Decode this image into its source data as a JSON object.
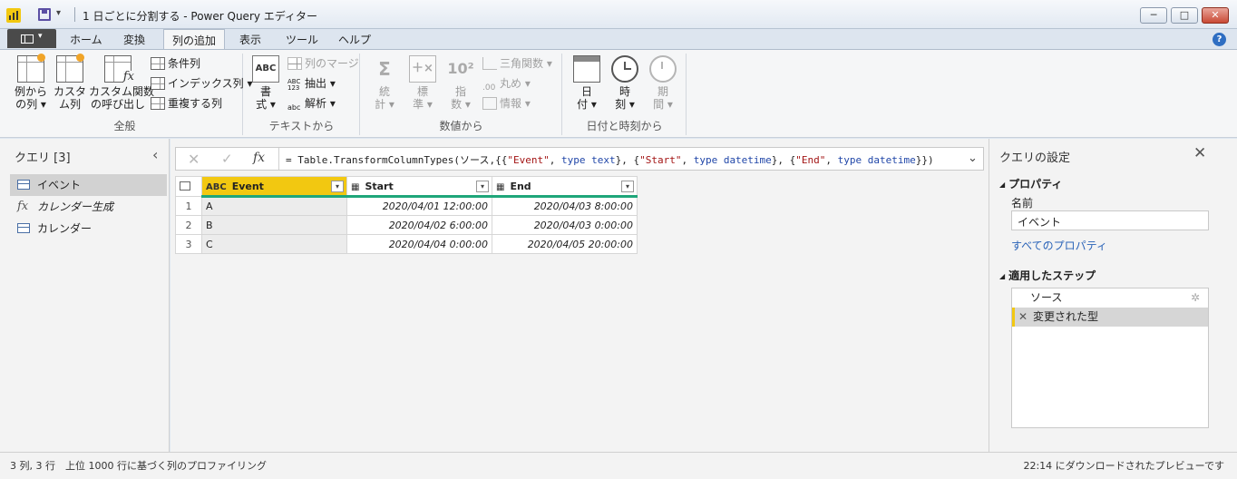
{
  "window": {
    "title": "1 日ごとに分割する - Power Query エディター",
    "qat_dropdown": "▾",
    "controls": {
      "minimize": "─",
      "maximize": "□",
      "close": "✕"
    }
  },
  "tabs": {
    "file_dropdown": "▾",
    "items": [
      "ホーム",
      "変換",
      "列の追加",
      "表示",
      "ツール",
      "ヘルプ"
    ],
    "active": "列の追加",
    "help": "?"
  },
  "ribbon": {
    "general": {
      "label": "全般",
      "example_col": "例から\nの列 ▾",
      "custom_col": "カスタ\nム列",
      "invoke_func": "カスタム関数\nの呼び出し",
      "conditional": "条件列",
      "index": "インデックス列 ▾",
      "duplicate": "重複する列"
    },
    "text": {
      "label": "テキストから",
      "format": "書\n式 ▾",
      "merge": "列のマージ",
      "extract": "抽出 ▾",
      "parse": "解析 ▾"
    },
    "number": {
      "label": "数値から",
      "stats": "統\n計 ▾",
      "standard": "標\n準 ▾",
      "scientific": "指\n数 ▾",
      "trig": "三角関数 ▾",
      "rounding": "丸め ▾",
      "info": "情報 ▾",
      "scientific_glyph": "10²"
    },
    "datetime": {
      "label": "日付と時刻から",
      "date": "日\n付 ▾",
      "time": "時\n刻 ▾",
      "duration": "期\n間 ▾"
    }
  },
  "queries": {
    "title": "クエリ [3]",
    "collapse": "‹",
    "items": [
      {
        "label": "イベント",
        "type": "table",
        "selected": true
      },
      {
        "label": "カレンダー生成",
        "type": "function",
        "selected": false
      },
      {
        "label": "カレンダー",
        "type": "table",
        "selected": false
      }
    ]
  },
  "formula_bar": {
    "cancel": "✕",
    "commit": "✓",
    "fx": "fx",
    "expand": "⌄",
    "text": "= Table.TransformColumnTypes(ソース,{{\"Event\", type text}, {\"Start\", type datetime}, {\"End\", type datetime}})"
  },
  "grid": {
    "columns": [
      {
        "name": "Event",
        "type": "ABC",
        "selected": true
      },
      {
        "name": "Start",
        "type": "datetime",
        "selected": false
      },
      {
        "name": "End",
        "type": "datetime",
        "selected": false
      }
    ],
    "rows": [
      [
        "1",
        "A",
        "2020/04/01 12:00:00",
        "2020/04/03 8:00:00"
      ],
      [
        "2",
        "B",
        "2020/04/02 6:00:00",
        "2020/04/03 0:00:00"
      ],
      [
        "3",
        "C",
        "2020/04/04 0:00:00",
        "2020/04/05 20:00:00"
      ]
    ],
    "dropdown": "▾"
  },
  "settings": {
    "title": "クエリの設定",
    "close": "✕",
    "properties_header": "プロパティ",
    "name_label": "名前",
    "name_value": "イベント",
    "all_props": "すべてのプロパティ",
    "steps_header": "適用したステップ",
    "section_toggle": "◢",
    "steps": [
      {
        "label": "ソース",
        "selected": false,
        "has_gear": true
      },
      {
        "label": "変更された型",
        "selected": true,
        "has_gear": false
      }
    ],
    "step_delete": "✕",
    "step_gear": "✲"
  },
  "status": {
    "size": "3 列, 3 行",
    "profiling": "上位 1000 行に基づく列のプロファイリング",
    "preview": "22:14 にダウンロードされたプレビューです"
  },
  "colors": {
    "accent_yellow": "#f2c811",
    "column_quality_green": "#1fa67a",
    "link_blue": "#2a63b8"
  }
}
